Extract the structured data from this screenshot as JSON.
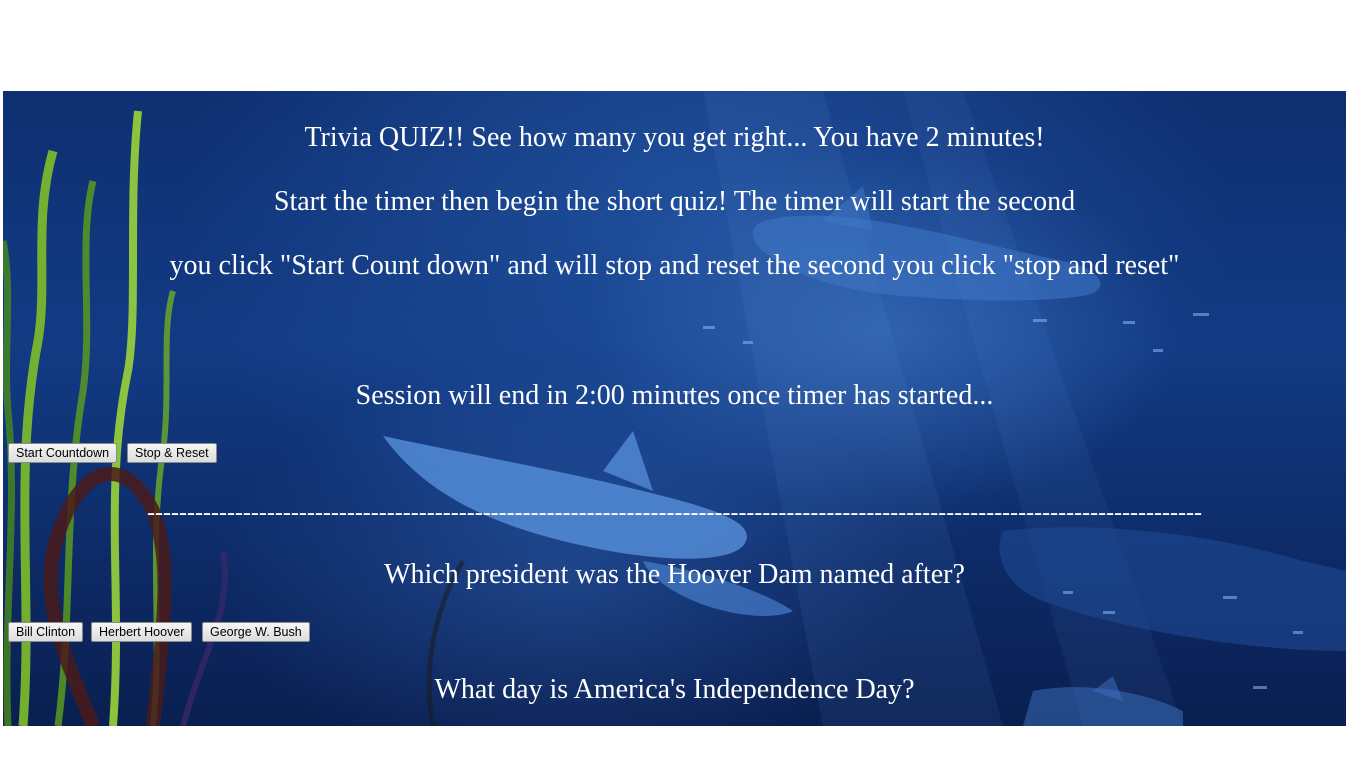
{
  "intro": {
    "title_line": "Trivia QUIZ!! See how many you get right... You have 2 minutes!",
    "instructions_line1": "Start the timer then begin the short quiz! The timer will start the second",
    "instructions_line2": "you click \"Start Count down\" and will stop and reset the second you click \"stop and reset\""
  },
  "timer": {
    "session_text": "Session will end in 2:00 minutes once timer has started...",
    "start_label": "Start Countdown",
    "stop_label": "Stop & Reset"
  },
  "divider": "------------------------------------------------------------------------------------------------------------------------------------",
  "questions": [
    {
      "text": "Which president was the Hoover Dam named after?",
      "options": [
        "Bill Clinton",
        "Herbert Hoover",
        "George W. Bush"
      ]
    },
    {
      "text": "What day is America's Independence Day?"
    }
  ]
}
